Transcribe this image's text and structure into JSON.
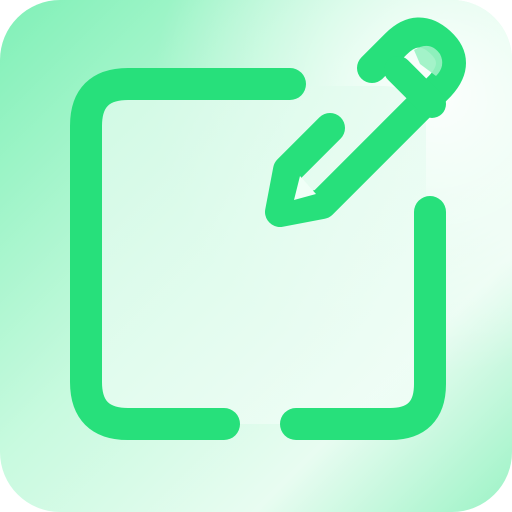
{
  "icon": {
    "name": "edit-icon",
    "colors": {
      "accent": "#27E07B",
      "tile_light": "#F6FFF9",
      "tile_mint": "#A9F5CC",
      "tile_mid": "#7FF0B6",
      "inner_fill": "#E9FCF2"
    }
  }
}
